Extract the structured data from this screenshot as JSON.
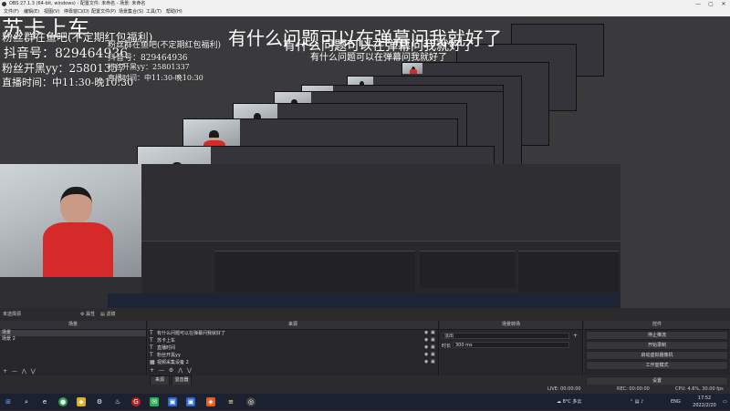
{
  "window": {
    "title": "OBS 27.1.3 (64-bit, windows) - 配置文件: 未命名 - 场景: 未命名",
    "minimize": "—",
    "maximize": "▢",
    "close": "✕"
  },
  "menu": [
    "文件(F)",
    "编辑(E)",
    "视图(V)",
    "停靠窗口(D)",
    "配置文件(P)",
    "场景集合(S)",
    "工具(T)",
    "帮助(H)"
  ],
  "overlay": {
    "title": "苏卡上车",
    "fan_group": "粉丝群在鱼吧(不定期红包福利)",
    "douyin": "抖音号：829464936",
    "fan_channel": "粉丝开黑yy：25801337",
    "live_time": "直播时间：中11:30-晚10:30",
    "scroll": "有什么问题可以在弹幕问我就好了"
  },
  "preview_source_label": "未选择源",
  "preview_props": "属性",
  "preview_filters": "滤镜",
  "scenes": {
    "title": "场景",
    "items": [
      "场景",
      "场景 2"
    ],
    "selected": 0
  },
  "sources": {
    "title": "来源",
    "items": [
      {
        "icon": "text-icon",
        "label": "有什么问题可以在弹幕问我就好了"
      },
      {
        "icon": "text-icon",
        "label": "苏卡上车"
      },
      {
        "icon": "text-icon",
        "label": "直播时间"
      },
      {
        "icon": "text-icon",
        "label": "粉丝开黑yy"
      },
      {
        "icon": "camera-icon",
        "label": "视频采集设备 2"
      }
    ]
  },
  "transitions": {
    "title": "场景转场",
    "type": "淡出",
    "duration_label": "时长",
    "duration_value": "300 ms"
  },
  "controls": {
    "title": "控件",
    "buttons": [
      "停止推流",
      "开始录制",
      "启动虚拟摄像机",
      "工作室模式",
      "设置",
      "退出"
    ]
  },
  "tabs": [
    "来源",
    "混音器"
  ],
  "status": {
    "live": "LIVE: 00:00:00",
    "rec": "REC: 00:00:00",
    "cpu": "CPU: 4.6%, 30.00 fps"
  },
  "taskbar": {
    "weather": "8°C 多云",
    "lang": "ENG",
    "time": "17:52",
    "date": "2022/2/20"
  },
  "colors": {
    "accent_red": "#d52a2a",
    "panel_bg": "#27272a",
    "taskbar_bg": "#1b2130"
  }
}
